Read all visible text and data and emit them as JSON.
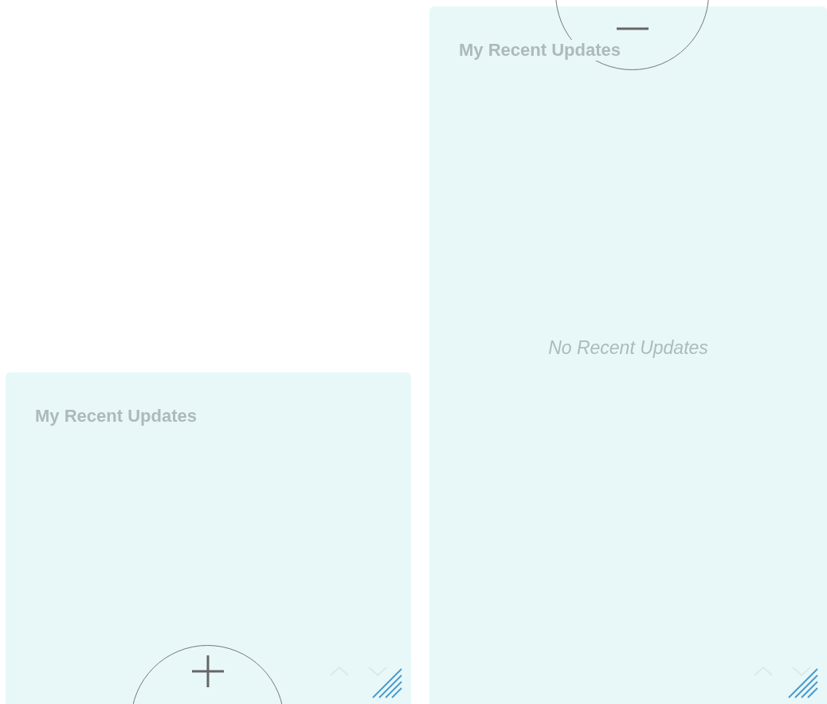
{
  "panels": [
    {
      "title": "My Recent Updates",
      "expanded": false
    },
    {
      "title": "My Recent Updates",
      "expanded": true,
      "empty_text": "No Recent Updates"
    }
  ]
}
